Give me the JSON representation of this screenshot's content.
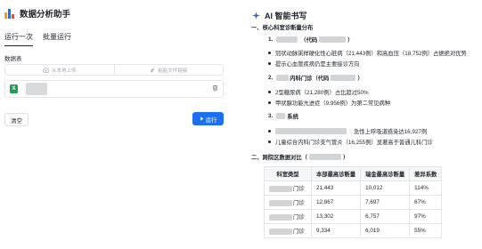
{
  "app": {
    "title": "数据分析助手"
  },
  "tabs": [
    {
      "label": "运行一次",
      "active": true
    },
    {
      "label": "批量运行",
      "active": false
    }
  ],
  "form": {
    "table_label": "数据表",
    "upload_local": "从本地上传",
    "upload_link": "粘贴文件链接",
    "file_type": "X"
  },
  "actions": {
    "clear": "清空",
    "run": "运行"
  },
  "report": {
    "title": "AI 智能书写",
    "section1": "一、核心科室诊断量分布",
    "item1_num": "1.",
    "item1_code": "（代码",
    "item1_code_end": "）",
    "item1_b1": "冠状动脉粥样硬化性心脏病（21,443例）和高血压（18,752例）占据绝对优势",
    "item1_b2": "提示心血管疾病仍是主要接诊方向",
    "item2_num": "2.",
    "item2_name": "内科门诊",
    "item2_code": "（代码",
    "item2_code_end": "）",
    "item2_b1": "2型糖尿病（21,280例）占比超过50%",
    "item2_b2": "甲状腺功能亢进症（9,956例）为第二常见病种",
    "item3_num": "3.",
    "item3_name": "系统",
    "item3_b1": "急性上呼吸道感染达16,927例",
    "item3_b2": "儿童综合内科门诊支气管炎（16,255例）显著高于普通儿科门诊",
    "section2": "二、跨院区数据对比（",
    "section2_end": "）",
    "table_headers": [
      "科室类型",
      "本部最高诊断量",
      "瑞金最高诊断量",
      "差异系数"
    ],
    "table_rows": [
      {
        "suffix": "门诊",
        "a": "21,443",
        "b": "10,012",
        "c": "114%"
      },
      {
        "suffix": "门诊",
        "a": "12,867",
        "b": "7,697",
        "c": "67%"
      },
      {
        "suffix": "门诊",
        "a": "13,302",
        "b": "6,757",
        "c": "97%"
      },
      {
        "suffix": "门诊",
        "a": "9,334",
        "b": "6,019",
        "c": "55%"
      }
    ]
  },
  "colors": {
    "primary": "#1d6ff2",
    "excel": "#1f9d55",
    "sparkle": "#3b5bdb"
  }
}
